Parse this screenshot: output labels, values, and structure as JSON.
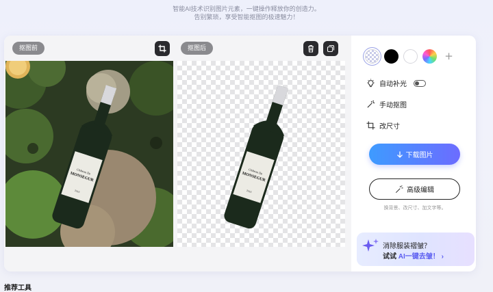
{
  "header": {
    "line1": "智能AI技术识别图片元素，一键操作释放你的创造力。",
    "line2": "告别繁琐，享受智能抠图的极速魅力！"
  },
  "preview": {
    "before_label": "抠图前",
    "after_label": "抠图后",
    "label_line1": "Château De",
    "label_line2": "MONSEGUR",
    "label_year": "2016"
  },
  "icons": {
    "crop": "crop-icon",
    "delete": "trash-icon",
    "copy": "copy-icon",
    "fill_light": "lightbulb-icon",
    "manual": "wand-icon",
    "resize": "resize-icon",
    "download": "arrow-down-icon",
    "edit": "magic-wand-icon",
    "sparkle": "sparkle-icon",
    "chevron": "chevron-right-icon"
  },
  "background_swatches": [
    {
      "name": "transparent",
      "selected": true
    },
    {
      "name": "black",
      "color": "#000000"
    },
    {
      "name": "white",
      "color": "#ffffff"
    },
    {
      "name": "custom-color"
    },
    {
      "name": "add"
    }
  ],
  "tools": {
    "auto_fill_light": "自动补光",
    "auto_fill_light_on": false,
    "manual_cutout": "手动抠图",
    "resize": "改尺寸"
  },
  "actions": {
    "download": "下载图片",
    "advanced_edit": "高级编辑",
    "hint": "换背景、改尺寸、加文字等。"
  },
  "promo": {
    "question": "消除服装褶皱？",
    "cta_prefix": "试试 ",
    "cta_highlight": "AI一键去皱！",
    "chevron": "›"
  },
  "section": {
    "recommended_tools": "推荐工具"
  },
  "colors": {
    "accent_start": "#3e9bff",
    "accent_end": "#6c6cff",
    "highlight": "#5a5cf0"
  }
}
